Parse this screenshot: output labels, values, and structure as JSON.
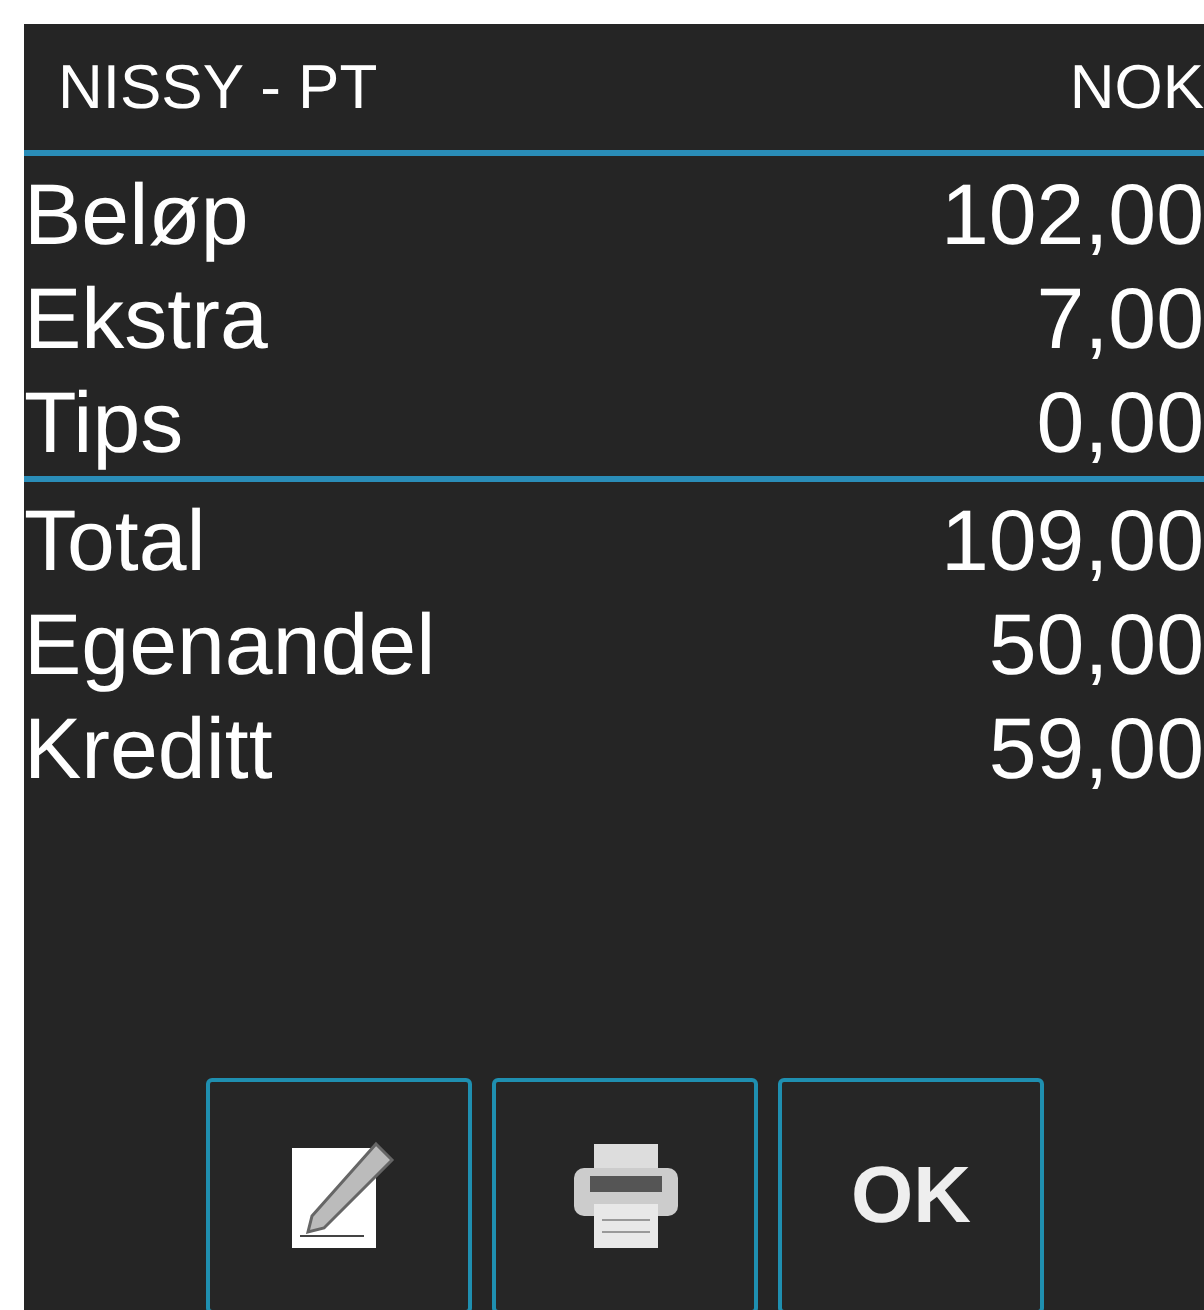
{
  "header": {
    "title": "NISSY - PT",
    "currency": "NOK"
  },
  "groups": [
    {
      "rows": [
        {
          "label": "Beløp",
          "value": "102,00"
        },
        {
          "label": "Ekstra",
          "value": "7,00"
        },
        {
          "label": "Tips",
          "value": "0,00"
        }
      ]
    },
    {
      "rows": [
        {
          "label": "Total",
          "value": "109,00"
        },
        {
          "label": "Egenandel",
          "value": "50,00"
        },
        {
          "label": "Kreditt",
          "value": "59,00"
        }
      ]
    }
  ],
  "buttons": [
    {
      "kind": "edit"
    },
    {
      "kind": "print"
    },
    {
      "kind": "text",
      "label": "OK"
    }
  ]
}
